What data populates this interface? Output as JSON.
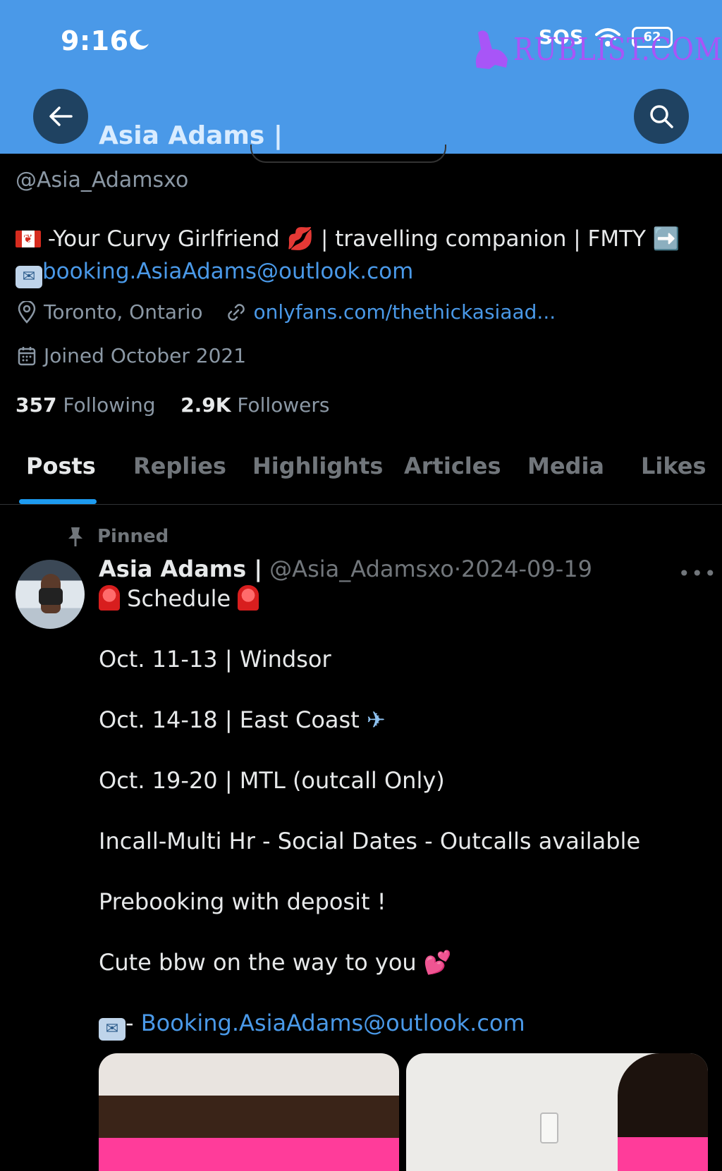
{
  "status_bar": {
    "time": "9:16",
    "sos": "SOS",
    "battery": "62"
  },
  "watermark": {
    "text": "RUBLIST.COM"
  },
  "header": {
    "title": "Asia Adams |"
  },
  "profile": {
    "handle": "@Asia_Adamsxo",
    "bio_line1": "-Your Curvy Girlfriend 💋 | travelling companion | FMTY ➡️",
    "bio_email": "booking.AsiaAdams@outlook.com",
    "location": "Toronto, Ontario",
    "website": "onlyfans.com/thethickasiaad...",
    "joined": "Joined October 2021",
    "following_count": "357",
    "following_label": "Following",
    "followers_count": "2.9K",
    "followers_label": "Followers"
  },
  "tabs": [
    {
      "label": "Posts"
    },
    {
      "label": "Replies"
    },
    {
      "label": "Highlights"
    },
    {
      "label": "Articles"
    },
    {
      "label": "Media"
    },
    {
      "label": "Likes"
    }
  ],
  "tweet": {
    "pinned_label": "Pinned",
    "author_name": "Asia Adams |",
    "author_handle": "@Asia_Adamsxo",
    "separator": "·",
    "date": "2024-09-19",
    "more": "•••",
    "headline": "Schedule",
    "line1": "Oct. 11-13 | Windsor",
    "line2": "Oct. 14-18 | East Coast",
    "line3": "Oct. 19-20 | MTL (outcall Only)",
    "line4": "Incall-Multi Hr - Social Dates - Outcalls available",
    "line5": "Prebooking with deposit !",
    "line6": "Cute bbw on the way to you",
    "email_prefix": "- ",
    "email": "Booking.AsiaAdams@outlook.com"
  },
  "colors": {
    "header_bg": "#4a99e8",
    "link": "#4a99e8",
    "accent": "#1d9bf0",
    "watermark": "#a855f7"
  },
  "icons": [
    "moon-icon",
    "wifi-icon",
    "back-arrow-icon",
    "search-icon",
    "location-icon",
    "link-icon",
    "calendar-icon",
    "pin-icon"
  ]
}
